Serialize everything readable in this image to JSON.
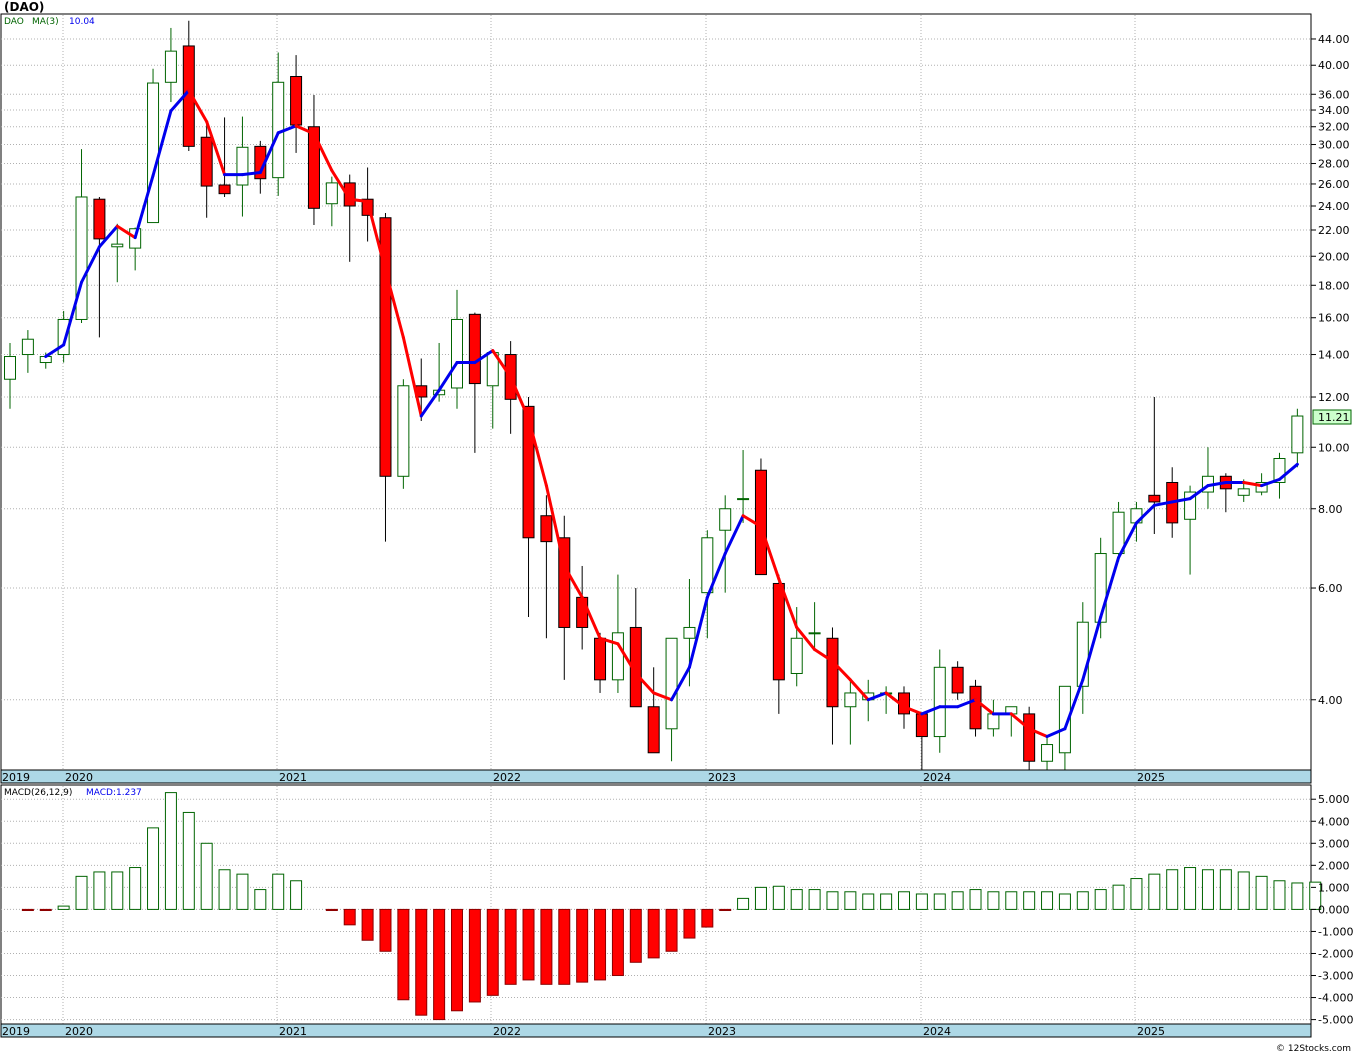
{
  "header": {
    "symbol": "(DAO)"
  },
  "price_legend": {
    "ticker": "DAO",
    "ma_label": "MA(3)",
    "ma_value": "10.04"
  },
  "macd_legend": {
    "params": "MACD(26,12,9)",
    "value_label": "MACD:1.237"
  },
  "last_price_tag": "11.21",
  "footer": {
    "copyright": "© 12Stocks.com"
  },
  "colors": {
    "up": "#ffffff",
    "up_border": "#006400",
    "down": "#ff0000",
    "ma_up": "#0000ee",
    "ma_down": "#ff0000",
    "macd_pos": "#006400",
    "macd_neg": "#ff0000",
    "axis_band": "#add8e6",
    "grid": "#b0b0b0",
    "price_tag": "#ccffcc"
  },
  "chart_data": [
    {
      "type": "candlestick",
      "title": "(DAO)",
      "y_scale": "log",
      "ylim": [
        3.1,
        48
      ],
      "y_ticks": [
        "4.00",
        "6.00",
        "8.00",
        "10.00",
        "12.00",
        "14.00",
        "16.00",
        "18.00",
        "20.00",
        "22.00",
        "24.00",
        "26.00",
        "28.00",
        "30.00",
        "32.00",
        "34.00",
        "36.00",
        "40.00",
        "44.00"
      ],
      "x_labels": [
        "2019",
        "2020",
        "2021",
        "2022",
        "2023",
        "2024",
        "2025"
      ],
      "grid": true,
      "series": [
        {
          "name": "DAO",
          "ohlc": [
            [
              12.8,
              14.6,
              11.5,
              13.9
            ],
            [
              14.0,
              15.3,
              13.1,
              14.8
            ],
            [
              13.6,
              14.1,
              13.3,
              13.9
            ],
            [
              14.0,
              16.4,
              13.6,
              15.9
            ],
            [
              15.9,
              29.5,
              15.7,
              24.8
            ],
            [
              24.6,
              24.8,
              14.9,
              21.3
            ],
            [
              20.7,
              22.5,
              18.2,
              20.9
            ],
            [
              20.6,
              22.2,
              19.0,
              22.1
            ],
            [
              22.6,
              39.5,
              22.6,
              37.5
            ],
            [
              37.6,
              45.8,
              35.0,
              42.1
            ],
            [
              42.9,
              47.0,
              29.3,
              29.8
            ],
            [
              30.8,
              32.4,
              23.0,
              25.8
            ],
            [
              25.9,
              33.1,
              24.8,
              25.1
            ],
            [
              25.9,
              33.2,
              23.1,
              29.7
            ],
            [
              29.8,
              30.4,
              25.1,
              26.5
            ],
            [
              26.6,
              41.9,
              24.9,
              37.6
            ],
            [
              38.4,
              41.5,
              29.1,
              32.2
            ],
            [
              32.0,
              35.9,
              22.4,
              23.8
            ],
            [
              24.2,
              26.7,
              22.3,
              26.1
            ],
            [
              26.1,
              26.9,
              19.6,
              24.0
            ],
            [
              24.6,
              27.6,
              21.1,
              23.2
            ],
            [
              23.0,
              23.4,
              7.1,
              9.0
            ],
            [
              9.0,
              12.8,
              8.6,
              12.5
            ],
            [
              12.5,
              13.8,
              11.0,
              12.0
            ],
            [
              12.1,
              14.6,
              11.8,
              12.3
            ],
            [
              12.4,
              17.7,
              11.5,
              15.9
            ],
            [
              16.2,
              16.3,
              9.8,
              12.6
            ],
            [
              12.5,
              13.6,
              10.7,
              14.1
            ],
            [
              14.0,
              14.7,
              10.5,
              11.9
            ],
            [
              11.6,
              12.0,
              5.4,
              7.2
            ],
            [
              7.8,
              8.4,
              5.0,
              7.1
            ],
            [
              7.2,
              7.8,
              4.3,
              5.2
            ],
            [
              5.8,
              6.5,
              4.8,
              5.2
            ],
            [
              5.0,
              5.1,
              4.1,
              4.3
            ],
            [
              4.3,
              6.3,
              4.1,
              5.1
            ],
            [
              5.2,
              6.0,
              3.9,
              3.9
            ],
            [
              3.9,
              4.5,
              3.3,
              3.3
            ],
            [
              3.6,
              5.0,
              3.2,
              5.0
            ],
            [
              5.0,
              6.2,
              4.2,
              5.2
            ],
            [
              5.9,
              7.4,
              5.0,
              7.2
            ],
            [
              7.4,
              8.4,
              5.9,
              8.0
            ],
            [
              8.3,
              9.9,
              7.6,
              8.3
            ],
            [
              9.2,
              9.6,
              6.3,
              6.3
            ],
            [
              6.1,
              6.3,
              3.8,
              4.3
            ],
            [
              4.4,
              5.6,
              4.2,
              5.0
            ],
            [
              5.1,
              5.7,
              4.8,
              5.1
            ],
            [
              5.0,
              5.2,
              3.4,
              3.9
            ],
            [
              3.9,
              4.3,
              3.4,
              4.1
            ],
            [
              4.0,
              4.3,
              3.7,
              4.1
            ],
            [
              4.1,
              4.2,
              3.8,
              4.1
            ],
            [
              4.1,
              4.2,
              3.6,
              3.8
            ],
            [
              3.8,
              3.8,
              3.0,
              3.5
            ],
            [
              3.5,
              4.8,
              3.3,
              4.5
            ],
            [
              4.5,
              4.6,
              4.0,
              4.1
            ],
            [
              4.2,
              4.3,
              3.5,
              3.6
            ],
            [
              3.6,
              4.0,
              3.5,
              3.8
            ],
            [
              3.8,
              3.9,
              3.5,
              3.9
            ],
            [
              3.8,
              3.9,
              3.0,
              3.2
            ],
            [
              3.2,
              3.5,
              3.1,
              3.4
            ],
            [
              3.3,
              4.2,
              3.1,
              4.2
            ],
            [
              4.2,
              5.7,
              3.8,
              5.3
            ],
            [
              5.3,
              7.2,
              5.0,
              6.8
            ],
            [
              6.8,
              8.2,
              6.6,
              7.9
            ],
            [
              7.6,
              8.2,
              7.1,
              8.0
            ],
            [
              8.4,
              12.0,
              7.3,
              8.2
            ],
            [
              8.8,
              9.3,
              7.2,
              7.6
            ],
            [
              7.7,
              8.7,
              6.3,
              8.5
            ],
            [
              8.5,
              10.0,
              8.0,
              9.0
            ],
            [
              9.0,
              9.1,
              7.9,
              8.6
            ],
            [
              8.4,
              8.9,
              8.2,
              8.6
            ],
            [
              8.5,
              9.1,
              8.4,
              8.8
            ],
            [
              8.8,
              9.8,
              8.3,
              9.6
            ],
            [
              9.8,
              11.5,
              9.3,
              11.2
            ]
          ]
        },
        {
          "name": "MA(3)",
          "values": [
            null,
            null,
            13.9,
            14.5,
            18.2,
            20.7,
            22.3,
            21.4,
            26.8,
            33.9,
            36.5,
            32.6,
            26.9,
            26.9,
            27.1,
            31.3,
            32.1,
            31.2,
            27.3,
            24.6,
            24.4,
            19.0,
            14.9,
            11.2,
            12.3,
            13.6,
            13.6,
            14.2,
            12.9,
            11.1,
            8.7,
            6.5,
            5.8,
            5.0,
            4.9,
            4.4,
            4.1,
            4.0,
            4.5,
            5.8,
            6.8,
            7.8,
            7.5,
            6.2,
            5.2,
            4.8,
            4.6,
            4.3,
            4.0,
            4.1,
            3.9,
            3.8,
            3.9,
            3.9,
            4.0,
            3.8,
            3.8,
            3.6,
            3.5,
            3.6,
            4.3,
            5.4,
            6.7,
            7.6,
            8.1,
            8.2,
            8.3,
            8.7,
            8.8,
            8.8,
            8.7,
            8.9,
            9.4
          ]
        }
      ]
    },
    {
      "type": "bar",
      "title": "MACD(26,12,9)",
      "ylim": [
        -5.2,
        5.6
      ],
      "y_ticks": [
        "5.000",
        "4.000",
        "3.000",
        "2.000",
        "1.000",
        "0.000",
        "-1.000",
        "-2.000",
        "-3.000",
        "-4.000",
        "-5.000"
      ],
      "x_labels": [
        "2019",
        "2020",
        "2021",
        "2022",
        "2023",
        "2024",
        "2025"
      ],
      "grid": true,
      "series": [
        {
          "name": "MACD",
          "values": [
            null,
            -0.05,
            -0.05,
            0.15,
            1.5,
            1.7,
            1.7,
            1.9,
            3.7,
            5.3,
            4.4,
            3.0,
            1.8,
            1.6,
            0.9,
            1.6,
            1.3,
            null,
            -0.05,
            -0.7,
            -1.4,
            -1.9,
            -4.1,
            -4.8,
            -5.0,
            -4.6,
            -4.2,
            -3.9,
            -3.4,
            -3.2,
            -3.4,
            -3.4,
            -3.3,
            -3.2,
            -3.0,
            -2.4,
            -2.2,
            -1.9,
            -1.3,
            -0.8,
            -0.05,
            0.5,
            1.0,
            1.05,
            0.9,
            0.9,
            0.8,
            0.8,
            0.7,
            0.7,
            0.8,
            0.7,
            0.7,
            0.8,
            0.9,
            0.8,
            0.8,
            0.8,
            0.8,
            0.7,
            0.8,
            0.9,
            1.1,
            1.4,
            1.6,
            1.8,
            1.9,
            1.8,
            1.8,
            1.7,
            1.5,
            1.3,
            1.2,
            1.237
          ]
        }
      ]
    }
  ]
}
